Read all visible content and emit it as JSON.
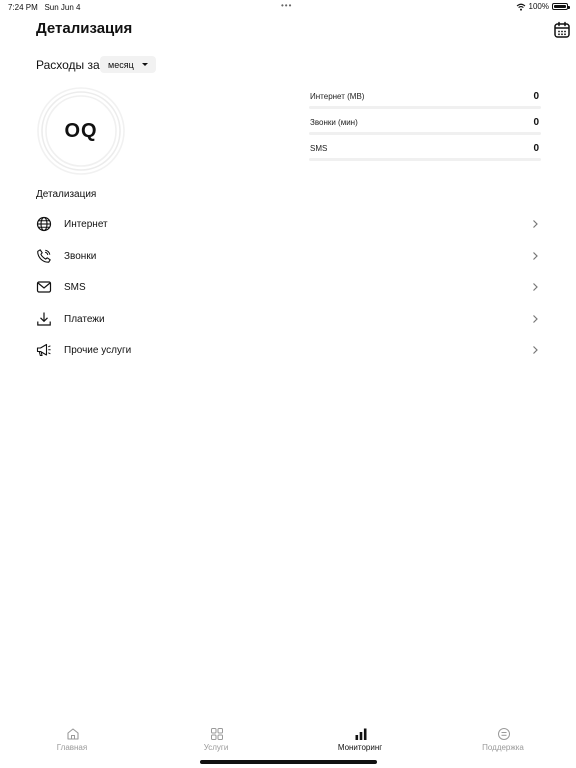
{
  "status_bar": {
    "time": "7:24 PM",
    "date": "Sun Jun 4",
    "dots": "•••",
    "battery": "100%"
  },
  "header": {
    "title": "Детализация",
    "calendar_icon": "calendar-icon"
  },
  "expenses": {
    "label": "Расходы за",
    "period_selected": "месяц"
  },
  "summary": {
    "logo_text": "OQ",
    "stats": [
      {
        "label": "Интернет (МВ)",
        "value": "0"
      },
      {
        "label": "Звонки (мин)",
        "value": "0"
      },
      {
        "label": "SMS",
        "value": "0"
      }
    ]
  },
  "details": {
    "title": "Детализация",
    "items": [
      {
        "label": "Интернет",
        "icon": "globe-icon"
      },
      {
        "label": "Звонки",
        "icon": "phone-icon"
      },
      {
        "label": "SMS",
        "icon": "envelope-icon"
      },
      {
        "label": "Платежи",
        "icon": "download-icon"
      },
      {
        "label": "Прочие услуги",
        "icon": "megaphone-icon"
      }
    ]
  },
  "tabbar": {
    "tabs": [
      {
        "label": "Главная",
        "icon": "home-icon",
        "active": false
      },
      {
        "label": "Услуги",
        "icon": "grid-icon",
        "active": false
      },
      {
        "label": "Мониторинг",
        "icon": "bar-chart-icon",
        "active": true
      },
      {
        "label": "Поддержка",
        "icon": "support-chat-icon",
        "active": false
      }
    ]
  },
  "colors": {
    "text": "#111111",
    "inactive_tab": "#9a9a9a",
    "track": "#f0f0f0",
    "select_bg": "#f2f2f2"
  }
}
